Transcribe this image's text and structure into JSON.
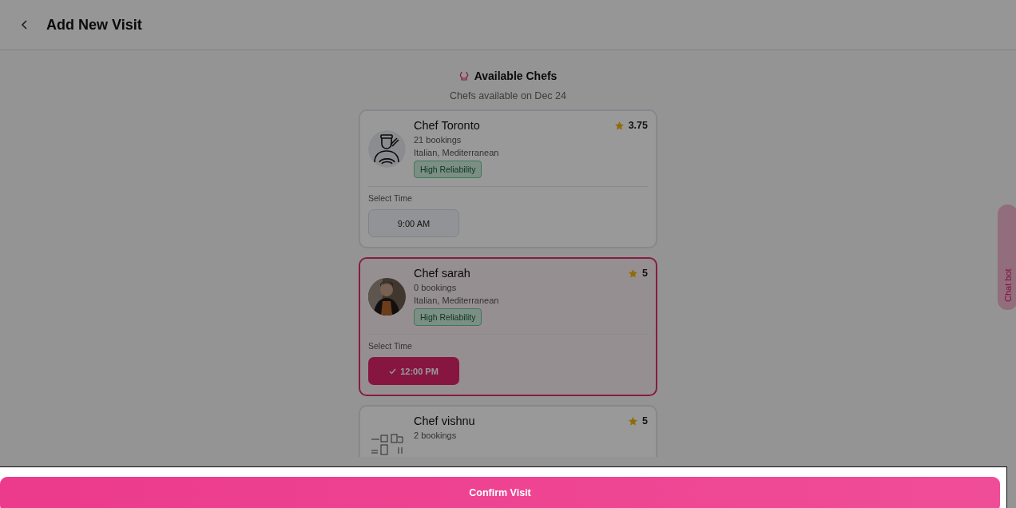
{
  "header": {
    "title": "Add New Visit"
  },
  "section": {
    "title": "Available Chefs",
    "subtitle": "Chefs available on Dec 24"
  },
  "chefs": [
    {
      "name": "Chef Toronto",
      "avatar": {
        "kind": "chef"
      },
      "rating": "3.75",
      "bookings": "21 bookings",
      "cuisines": "Italian, Mediterranean",
      "badge": "High Reliability",
      "selected": false,
      "time_label": "Select Time",
      "slots": [
        {
          "label": "9:00 AM",
          "selected": false
        }
      ]
    },
    {
      "name": "Chef sarah",
      "rating": "5",
      "bookings": "0 bookings",
      "cuisines": "Italian, Mediterranean",
      "badge": "High Reliability",
      "selected": true,
      "time_label": "Select Time",
      "slots": [
        {
          "label": "12:00 PM",
          "selected": true
        }
      ]
    },
    {
      "name": "Chef vishnu",
      "avatar": {
        "kind": "kitchen"
      },
      "rating": "5",
      "bookings": "2 bookings",
      "selected": false
    }
  ],
  "chat_tab": {
    "label": "Chat bot"
  },
  "confirm_button": {
    "label": "Confirm Visit"
  }
}
